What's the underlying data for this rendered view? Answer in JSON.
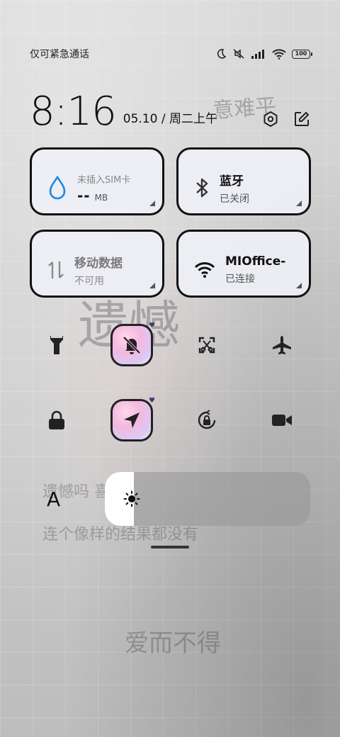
{
  "status_bar": {
    "carrier": "仅可紧急通话",
    "battery": "100"
  },
  "header": {
    "time": "8:16",
    "date": "05.10 / 周二上午"
  },
  "tiles": {
    "data_usage": {
      "label": "未插入SIM卡",
      "value": "--",
      "unit": "MB"
    },
    "bluetooth": {
      "label": "蓝牙",
      "status": "已关闭"
    },
    "mobile_data": {
      "label": "移动数据",
      "status": "不可用"
    },
    "wifi": {
      "label": "MIOffice-",
      "status": "已连接"
    }
  },
  "brightness": {
    "auto_label": "A",
    "level": 0.14
  },
  "decor": {
    "line1": "意难平",
    "line2": "遗憾",
    "line3": "遗憾吗 喜欢",
    "line4": "连个像样的结果都没有",
    "line5": "爱而不得"
  },
  "icons": [
    "moon-icon",
    "mute-icon",
    "signal-icon",
    "wifi-icon",
    "settings-icon",
    "edit-icon",
    "water-drop-icon",
    "bluetooth-icon",
    "swap-arrows-icon",
    "flashlight-icon",
    "bell-off-icon",
    "screenshot-icon",
    "airplane-icon",
    "lock-icon",
    "location-icon",
    "rotation-lock-icon",
    "video-icon",
    "sun-icon"
  ],
  "colors": {
    "accent": "#1e88e5",
    "tile_border": "#111111"
  }
}
